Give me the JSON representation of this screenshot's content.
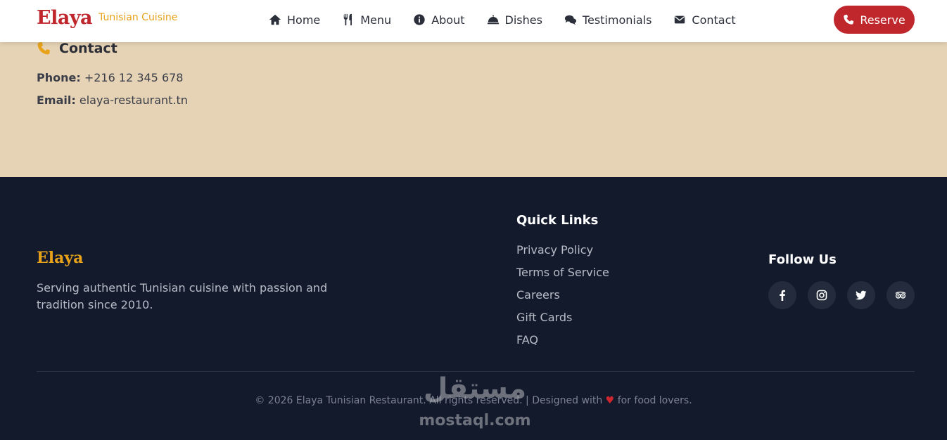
{
  "nav": {
    "brand_name": "Elaya",
    "brand_tagline": "Tunisian Cuisine",
    "items": [
      {
        "label": "Home",
        "icon": "home-icon"
      },
      {
        "label": "Menu",
        "icon": "utensils-icon"
      },
      {
        "label": "About",
        "icon": "info-icon"
      },
      {
        "label": "Dishes",
        "icon": "cloche-icon"
      },
      {
        "label": "Testimonials",
        "icon": "comments-icon"
      },
      {
        "label": "Contact",
        "icon": "envelope-icon"
      }
    ],
    "reserve_label": "Reserve"
  },
  "contact": {
    "heading": "Contact",
    "phone_label": "Phone:",
    "phone_value": "+216 12 345 678",
    "email_label": "Email:",
    "email_value": "elaya-restaurant.tn"
  },
  "footer": {
    "brand": "Elaya",
    "description": "Serving authentic Tunisian cuisine with passion and tradition since 2010.",
    "quick_links_title": "Quick Links",
    "quick_links": [
      "Privacy Policy",
      "Terms of Service",
      "Careers",
      "Gift Cards",
      "FAQ"
    ],
    "follow_title": "Follow Us",
    "socials": [
      "facebook-icon",
      "instagram-icon",
      "twitter-icon",
      "tripadvisor-icon"
    ],
    "copyright_left": "© 2026 Elaya Tunisian Restaurant. All rights reserved. | Designed with",
    "copyright_right": "for food lovers."
  },
  "watermark": {
    "arabic": "مستقل",
    "latin": "mostaql.com"
  },
  "colors": {
    "brand_red": "#c0272d",
    "accent_gold": "#e8a21a",
    "sand": "#e6d3b5",
    "footer_navy": "#131a2c"
  }
}
